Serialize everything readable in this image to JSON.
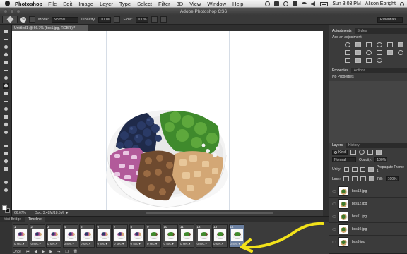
{
  "menubar": {
    "app": "Photoshop",
    "items": [
      "File",
      "Edit",
      "Image",
      "Layer",
      "Type",
      "Select",
      "Filter",
      "3D",
      "View",
      "Window",
      "Help"
    ],
    "clock": "Sun 3:03 PM",
    "user": "Alison Ebright"
  },
  "window": {
    "title": "Adobe Photoshop CS6"
  },
  "options": {
    "brush_size": "70",
    "mode_label": "Mode:",
    "mode_value": "Normal",
    "opacity_label": "Opacity:",
    "opacity_value": "100%",
    "flow_label": "Flow:",
    "flow_value": "100%",
    "workspace": "Essentials"
  },
  "document": {
    "tab_title": "Untitled1 @ 66.7% (bcs1.jpg, RGB/8) *",
    "zoom": "66.67%",
    "doc_size": "Doc: 3.42M/18.5M"
  },
  "timeline": {
    "tabs": [
      "Mini Bridge",
      "Timeline"
    ],
    "frames": [
      {
        "num": "1",
        "delay": "0 sec.▾"
      },
      {
        "num": "2",
        "delay": "0 sec.▾"
      },
      {
        "num": "3",
        "delay": "0 sec.▾"
      },
      {
        "num": "4",
        "delay": "0 sec.▾"
      },
      {
        "num": "5",
        "delay": "0 sec.▾"
      },
      {
        "num": "6",
        "delay": "0 sec.▾"
      },
      {
        "num": "7",
        "delay": "0 sec.▾"
      },
      {
        "num": "8",
        "delay": "0 sec.▾"
      },
      {
        "num": "9",
        "delay": "0 sec.▾"
      },
      {
        "num": "10",
        "delay": "0 sec.▾"
      },
      {
        "num": "11",
        "delay": "0 sec.▾"
      },
      {
        "num": "12",
        "delay": "0 sec.▾"
      },
      {
        "num": "13",
        "delay": "0 sec.▾"
      },
      {
        "num": "14",
        "delay": "0 sec.▾"
      }
    ],
    "loop": "Once"
  },
  "panels": {
    "adjustments_tabs": [
      "Adjustments",
      "Styles"
    ],
    "add_adjustment": "Add an adjustment",
    "properties_tabs": [
      "Properties",
      "Actions"
    ],
    "no_properties": "No Properties",
    "layers_tabs": [
      "Layers",
      "History"
    ],
    "kind_label": "Kind",
    "blend_mode": "Normal",
    "opacity_label": "Opacity:",
    "opacity_value": "100%",
    "unify_label": "Unify:",
    "propagate_label": "Propagate Frame 1",
    "lock_label": "Lock:",
    "fill_label": "Fill:",
    "fill_value": "100%",
    "layers": [
      "bcs13.jpg",
      "bcs12.jpg",
      "bcs11.jpg",
      "bcs10.jpg",
      "bcs9.jpg"
    ]
  },
  "colors": {
    "ui_dark": "#3b3b3b",
    "selected_frame": "#6a7fa0",
    "annotation": "#f2e21a"
  },
  "icons": [
    "apple-icon",
    "search-icon",
    "eye-icon",
    "brush-icon",
    "arrow-annotation-icon"
  ]
}
